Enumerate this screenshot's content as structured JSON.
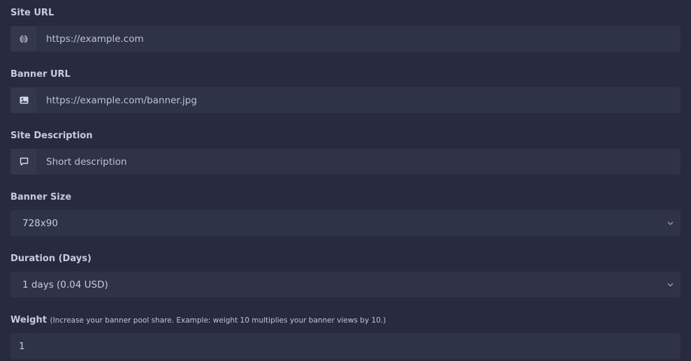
{
  "form": {
    "site_url": {
      "label": "Site URL",
      "value": "https://example.com",
      "icon": "globe-icon"
    },
    "banner_url": {
      "label": "Banner URL",
      "value": "https://example.com/banner.jpg",
      "icon": "image-icon"
    },
    "site_description": {
      "label": "Site Description",
      "placeholder": "Short description",
      "icon": "comment-icon"
    },
    "banner_size": {
      "label": "Banner Size",
      "selected": "728x90"
    },
    "duration": {
      "label": "Duration (Days)",
      "selected": "1 days (0.04 USD)"
    },
    "weight": {
      "label": "Weight",
      "hint": "(Increase your banner pool share. Example: weight 10 multiplies your banner views by 10.)",
      "value": "1"
    }
  },
  "colors": {
    "background": "#262a3b",
    "field": "#2f3347",
    "addon": "#33384d",
    "label": "#c6cbe0"
  }
}
